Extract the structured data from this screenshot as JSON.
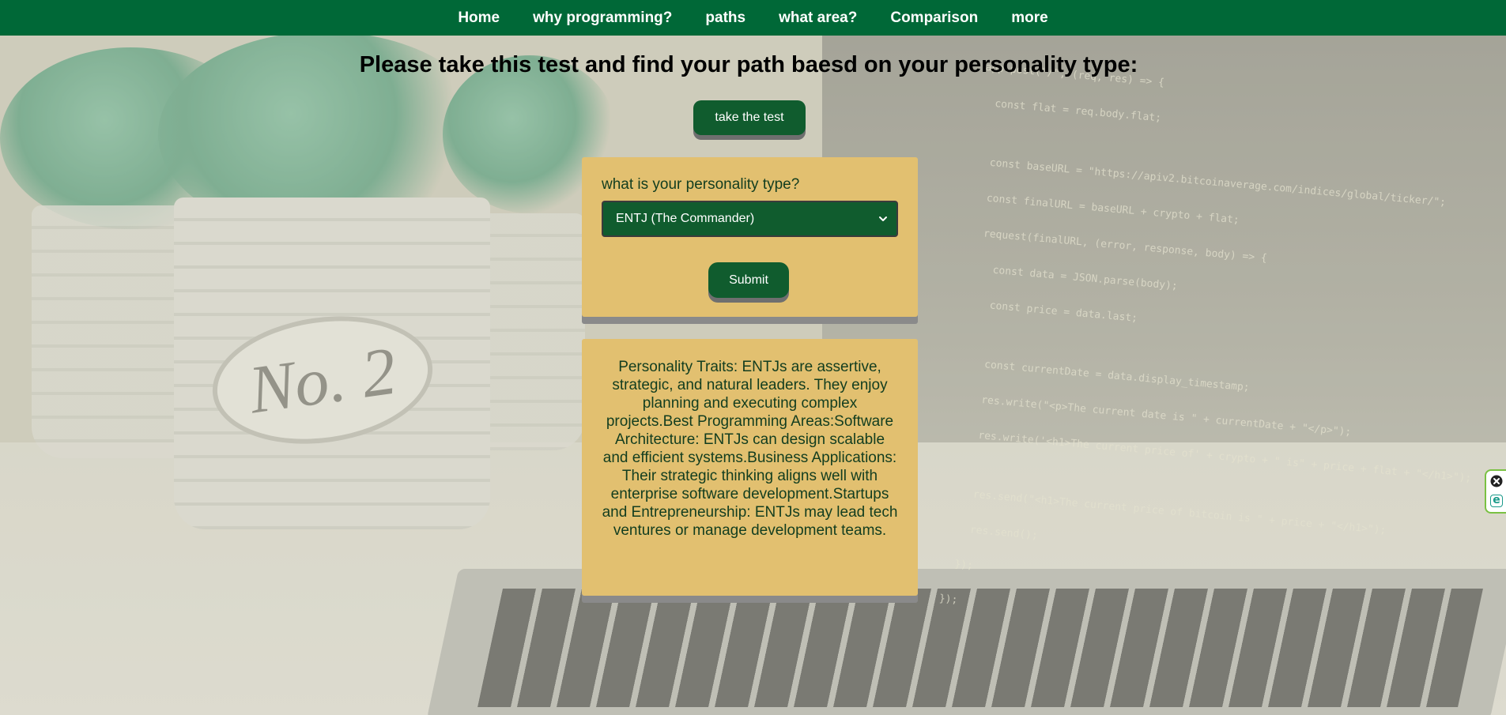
{
  "nav": {
    "items": [
      {
        "label": "Home"
      },
      {
        "label": "why programming?"
      },
      {
        "label": "paths"
      },
      {
        "label": "what area?"
      },
      {
        "label": "Comparison"
      },
      {
        "label": "more"
      }
    ]
  },
  "main": {
    "title": "Please take this test and find your path baesd on your personality type:",
    "test_button_label": "take the test"
  },
  "form": {
    "question": "what is your personality type?",
    "selected_value": "ENTJ (The Commander)",
    "submit_label": "Submit"
  },
  "result": {
    "text": "Personality Traits: ENTJs are assertive, strategic, and natural leaders. They enjoy planning and executing complex projects.Best Programming Areas:Software Architecture: ENTJs can design scalable and efficient systems.Business Applications: Their strategic thinking aligns well with enterprise software development.Startups and Entrepreneurship: ENTJs may lead tech ventures or manage development teams."
  },
  "background": {
    "pot_label": "No. 2",
    "code_lines": [
      "app.post(\"/\", (req, res) => {",
      "  const flat = req.body.flat;",
      "",
      "  const baseURL = \"https://apiv2.bitcoinaverage.com/indices/global/ticker/\";",
      "  const finalURL = baseURL + crypto + flat;",
      "  request(finalURL, (error, response, body) => {",
      "    const data = JSON.parse(body);",
      "    const price = data.last;",
      "",
      "    const currentDate = data.display_timestamp;",
      "    res.write(\"<p>The current date is \" + currentDate + \"</p>\");",
      "    res.write('<h1>The current price of' + crypto + \" is\" + price + flat + \"</h1>\");",
      "",
      "    res.send(\"<h1>The current price of bitcoin is \" + price + \"</h1>\");",
      "    res.send();",
      "  });",
      "});"
    ]
  },
  "colors": {
    "nav_green": "#006837",
    "button_green": "#105c2e",
    "card_tan": "#e2c070",
    "text_dark_green": "#123d1f"
  },
  "icons": {
    "select_arrow": "chevron-down-icon",
    "widget_close": "close-icon",
    "widget_e": "e-icon"
  }
}
